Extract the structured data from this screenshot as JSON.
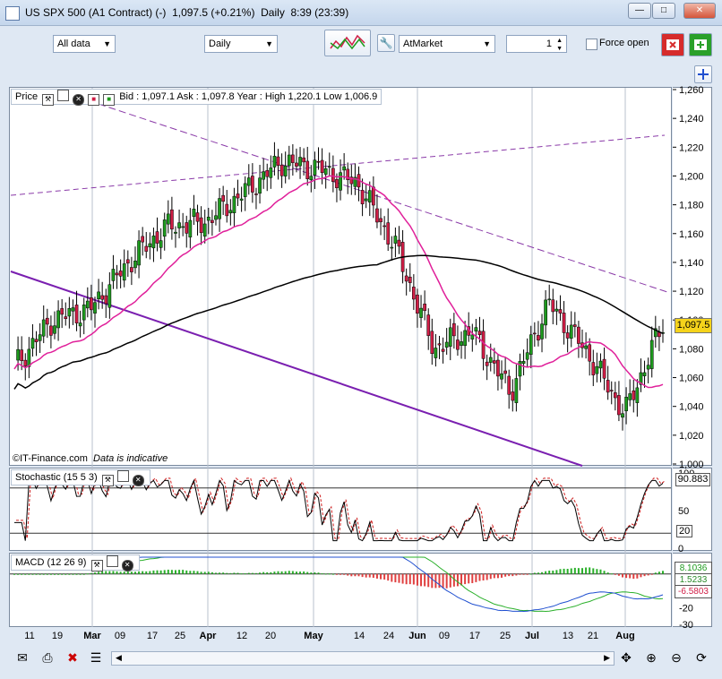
{
  "window": {
    "title": "US SPX 500 (A1 Contract) (-)",
    "price": "1,097.5 (+0.21%)",
    "period": "Daily",
    "time": "8:39 (23:39)",
    "min": "—",
    "max": "□",
    "close": "✕"
  },
  "toolbar": {
    "range": "All data",
    "interval": "Daily",
    "order_type": "AtMarket",
    "quantity": "1",
    "force_open": "Force open"
  },
  "price_panel": {
    "label": "Price",
    "quote": "Bid : 1,097.1 Ask : 1,097.8 Year : High 1,220.1 Low 1,006.9",
    "source_label": "©IT-Finance.com",
    "note": "Data is indicative",
    "last_price": "1,097.5",
    "y_ticks": [
      "1,260",
      "1,240",
      "1,220",
      "1,200",
      "1,180",
      "1,160",
      "1,140",
      "1,120",
      "1,100",
      "1,080",
      "1,060",
      "1,040",
      "1,020",
      "1,000"
    ]
  },
  "stochastic": {
    "label": "Stochastic (15 5 3)",
    "value": "90.883",
    "level_low": "20",
    "tick_top": "100",
    "tick_mid": "50",
    "tick_zero": "0"
  },
  "macd": {
    "label": "MACD (12 26 9)",
    "value1": "8.1036",
    "value2": "1.5233",
    "value3": "-6.5803",
    "tick_minus10": "-10",
    "tick_minus20": "-20",
    "tick_minus30": "-30"
  },
  "x_axis": {
    "labels": [
      "11",
      "19",
      "Mar",
      "09",
      "17",
      "25",
      "Apr",
      "12",
      "20",
      "May",
      "14",
      "24",
      "Jun",
      "09",
      "17",
      "25",
      "Jul",
      "13",
      "21",
      "Aug"
    ]
  },
  "chart_data": [
    {
      "type": "candlestick",
      "title": "",
      "ylim": [
        1000,
        1260
      ],
      "x": [
        "11",
        "19",
        "Mar",
        "09",
        "17",
        "25",
        "Apr",
        "12",
        "20",
        "May",
        "14",
        "24",
        "Jun",
        "09",
        "17",
        "25",
        "Jul",
        "13"
      ],
      "close": [
        1068,
        1100,
        1108,
        1140,
        1165,
        1168,
        1188,
        1210,
        1205,
        1195,
        1150,
        1080,
        1092,
        1050,
        1112,
        1078,
        1035,
        1097.5
      ],
      "series": [],
      "colors": {
        "up": "#1e9b1e",
        "down": "#d01e46",
        "ma_short": "#e0209a",
        "ma_long": "#000000",
        "trend_solid": "#7a1fb0",
        "trend_dashed": "#8a3aa8"
      }
    },
    {
      "type": "line",
      "title": "",
      "ylim": [
        0,
        100
      ],
      "series": [],
      "colors": {
        "k": "#000000",
        "d": "#d02020"
      }
    },
    {
      "type": "area",
      "title": "",
      "ylim": [
        -30,
        10
      ],
      "series": [],
      "colors": {
        "hist_pos": "#2ab02a",
        "hist_neg": "#e04040",
        "macd": "#1f4fd0",
        "signal": "#2ab02a",
        "fill_neg": "#f2b8b8",
        "fill_pos": "#b8e2b8"
      }
    }
  ],
  "icons": [
    "save-icon",
    "print-icon",
    "delete-icon",
    "list-icon",
    "scroll-left-icon",
    "scroll-right-icon",
    "pan-icon",
    "zoom-in-icon",
    "zoom-out-icon",
    "refresh-icon"
  ]
}
